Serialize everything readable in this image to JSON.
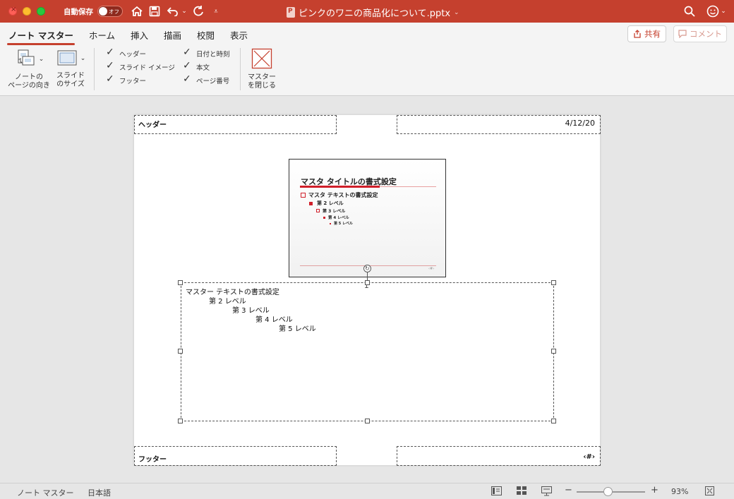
{
  "titlebar": {
    "autosave_label": "自動保存",
    "toggle_text": "オフ",
    "doc_title": "ピンクのワニの商品化について.pptx"
  },
  "ribbon": {
    "tabs": [
      "ノート マスター",
      "ホーム",
      "挿入",
      "描画",
      "校閲",
      "表示"
    ],
    "share_label": "共有",
    "comment_label": "コメント",
    "orientation_label": "ノートの\nページの向き",
    "slide_size_label": "スライド\nのサイズ",
    "close_master_label": "マスター\nを閉じる",
    "checkboxes": [
      "ヘッダー",
      "スライド イメージ",
      "フッター",
      "日付と時刻",
      "本文",
      "ページ番号"
    ]
  },
  "page": {
    "header_text": "ヘッダー",
    "date_text": "4/12/20",
    "footer_text": "フッター",
    "page_num_text": "‹#›",
    "thumb_title": "マスタ タイトルの書式設定",
    "thumb_lines": [
      "マスタ テキストの書式設定",
      "第 2 レベル",
      "第 3 レベル",
      "第 4 レベル",
      "第 5 レベル"
    ],
    "thumb_num": "‹#›",
    "body_lines": [
      "マスター テキストの書式設定",
      "第 2 レベル",
      "第 3 レベル",
      "第 4 レベル",
      "第 5 レベル"
    ]
  },
  "statusbar": {
    "view_name": "ノート マスター",
    "language": "日本語",
    "zoom": "93%",
    "zoom_level": 0.4
  },
  "colors": {
    "accent": "#c5402e",
    "bullet_red": "#d01f2a"
  }
}
